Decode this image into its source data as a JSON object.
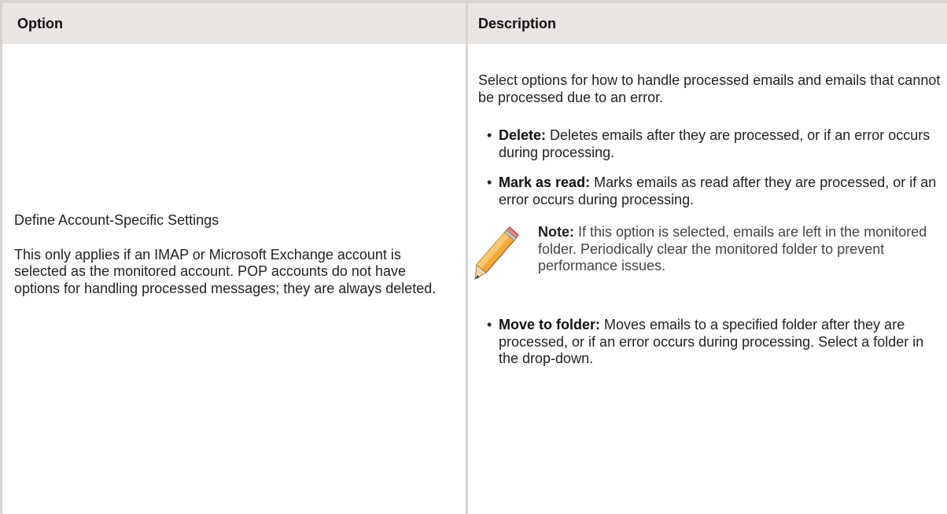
{
  "header": {
    "option": "Option",
    "description": "Description"
  },
  "option_cell": {
    "title": "Define Account-Specific Settings",
    "body": "This only applies if an IMAP or Microsoft Exchange account is selected as the monitored account. POP accounts do not have options for handling processed messages; they are always deleted."
  },
  "description_cell": {
    "intro": "Select options for how to handle processed emails and emails that cannot be processed due to an error.",
    "bullets": [
      {
        "term": "Delete:",
        "text": "Deletes emails after they are processed, or if an error occurs during processing."
      },
      {
        "term": "Mark as read:",
        "text": "Marks emails as read after they are processed, or if an error occurs during processing."
      },
      {
        "term": "Move to folder:",
        "text": "Moves emails to a specified folder after they are processed, or if an error occurs during processing. Select a folder in the drop-down."
      }
    ],
    "note": {
      "label": "Note:",
      "text": "If this option is selected, emails are left in the monitored folder. Periodically clear the monitored folder to prevent performance issues.",
      "icon": "pencil-icon"
    }
  },
  "colors": {
    "header_bg": "#e8e5e2",
    "border": "#d6d3d0",
    "text": "#222222"
  }
}
